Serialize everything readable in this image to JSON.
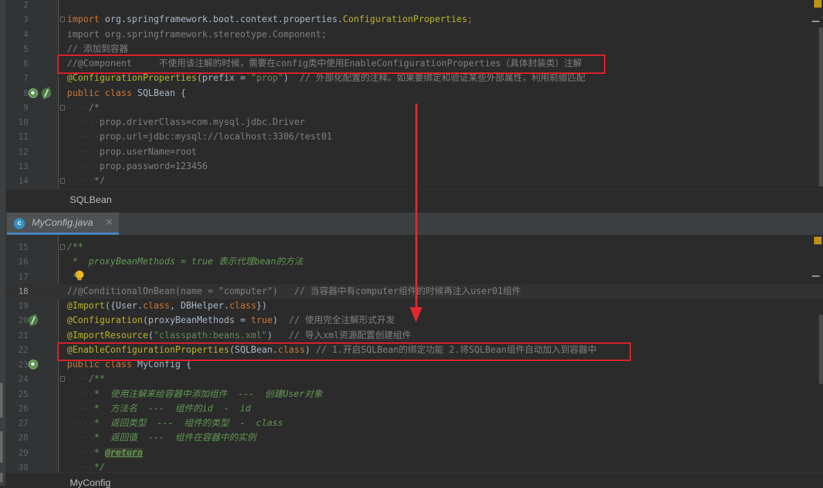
{
  "top_editor": {
    "lines": [
      {
        "num": "2",
        "tokens": []
      },
      {
        "num": "3",
        "tokens": [
          {
            "t": "import ",
            "c": "kw"
          },
          {
            "t": "org.springframework.boot.context.properties."
          },
          {
            "t": "ConfigurationProperties",
            "c": "ann"
          },
          {
            "t": ";",
            "c": "kw"
          }
        ]
      },
      {
        "num": "4",
        "tokens": [
          {
            "t": "import ",
            "c": "cmt"
          },
          {
            "t": "org.springframework.stereotype.Component;",
            "c": "cmt"
          }
        ]
      },
      {
        "num": "5",
        "tokens": [
          {
            "t": "// 添加到容器",
            "c": "cmt"
          }
        ]
      },
      {
        "num": "6",
        "tokens": [
          {
            "t": "//@Component     不使用该注解的时候，需要在config类中使用EnableConfigurationProperties（具体封装类）注解",
            "c": "cmt"
          }
        ]
      },
      {
        "num": "7",
        "tokens": [
          {
            "t": "@ConfigurationProperties",
            "c": "ann"
          },
          {
            "t": "("
          },
          {
            "t": "prefix"
          },
          {
            "t": " = "
          },
          {
            "t": "\"prop\"",
            "c": "str"
          },
          {
            "t": ")  "
          },
          {
            "t": "// 外部化配置的注释。如果要绑定和验证某些外部属性，利用前缀匹配",
            "c": "cmt"
          }
        ]
      },
      {
        "num": "8",
        "tokens": [
          {
            "t": "public ",
            "c": "kw"
          },
          {
            "t": "class ",
            "c": "kw"
          },
          {
            "t": "SQLBean {"
          }
        ]
      },
      {
        "num": "9",
        "tokens": [
          {
            "t": "····",
            "c": "ws"
          },
          {
            "t": "/*",
            "c": "cmt"
          }
        ]
      },
      {
        "num": "10",
        "tokens": [
          {
            "t": "······",
            "c": "ws"
          },
          {
            "t": "prop.driverClass=com.mysql.jdbc.Driver",
            "c": "cmt"
          }
        ]
      },
      {
        "num": "11",
        "tokens": [
          {
            "t": "······",
            "c": "ws"
          },
          {
            "t": "prop.url=jdbc:mysql://localhost:3306/test01",
            "c": "cmt"
          }
        ]
      },
      {
        "num": "12",
        "tokens": [
          {
            "t": "······",
            "c": "ws"
          },
          {
            "t": "prop.userName=root",
            "c": "cmt"
          }
        ]
      },
      {
        "num": "13",
        "tokens": [
          {
            "t": "······",
            "c": "ws"
          },
          {
            "t": "prop.password=123456",
            "c": "cmt"
          }
        ]
      },
      {
        "num": "14",
        "tokens": [
          {
            "t": "·····",
            "c": "ws"
          },
          {
            "t": "*/",
            "c": "cmt"
          }
        ]
      }
    ],
    "breadcrumb": "SQLBean"
  },
  "tab": {
    "icon_letter": "c",
    "title": "MyConfig.java",
    "close": "×"
  },
  "bottom_editor": {
    "lines": [
      {
        "num": "15",
        "tokens": [
          {
            "t": "/**",
            "c": "doc"
          }
        ]
      },
      {
        "num": "16",
        "tokens": [
          {
            "t": " *  proxyBeanMethods = true 表示代理bean的方法",
            "c": "doc"
          }
        ]
      },
      {
        "num": "17",
        "tokens": [
          {
            "t": " *",
            "c": "doc"
          }
        ]
      },
      {
        "num": "18",
        "tokens": [
          {
            "t": "//@ConditionalOnBean(name = \"computer\")   // 当容器中有computer组件的时候再注入user01组件",
            "c": "cmt"
          }
        ]
      },
      {
        "num": "19",
        "tokens": [
          {
            "t": "@Import",
            "c": "ann"
          },
          {
            "t": "({User."
          },
          {
            "t": "class",
            "c": "kw"
          },
          {
            "t": ", "
          },
          {
            "t": "DBHelper."
          },
          {
            "t": "class",
            "c": "kw"
          },
          {
            "t": "})"
          }
        ]
      },
      {
        "num": "20",
        "tokens": [
          {
            "t": "@Configuration",
            "c": "ann"
          },
          {
            "t": "(proxyBeanMethods = "
          },
          {
            "t": "true",
            "c": "kw"
          },
          {
            "t": ")  "
          },
          {
            "t": "// 使用完全注解形式开发",
            "c": "cmt"
          }
        ]
      },
      {
        "num": "21",
        "tokens": [
          {
            "t": "@ImportResource",
            "c": "ann"
          },
          {
            "t": "("
          },
          {
            "t": "\"classpath:beans.xml\"",
            "c": "str"
          },
          {
            "t": ")   "
          },
          {
            "t": "// 导入xml资源配置创建组件",
            "c": "cmt"
          }
        ]
      },
      {
        "num": "22",
        "tokens": [
          {
            "t": "@EnableConfigurationProperties",
            "c": "ann"
          },
          {
            "t": "(SQLBean."
          },
          {
            "t": "class",
            "c": "kw"
          },
          {
            "t": ") "
          },
          {
            "t": "// 1.开启SQLBean的绑定功能 2.将SQLBean组件自动加入到容器中",
            "c": "cmt"
          }
        ]
      },
      {
        "num": "23",
        "tokens": [
          {
            "t": "public ",
            "c": "kw"
          },
          {
            "t": "class ",
            "c": "kw"
          },
          {
            "t": "MyConfig {"
          }
        ]
      },
      {
        "num": "24",
        "tokens": [
          {
            "t": "····",
            "c": "ws"
          },
          {
            "t": "/**",
            "c": "doc"
          }
        ]
      },
      {
        "num": "25",
        "tokens": [
          {
            "t": "·····",
            "c": "ws"
          },
          {
            "t": "*  使用注解来给容器中添加组件  ---  创建User对象",
            "c": "doc"
          }
        ]
      },
      {
        "num": "26",
        "tokens": [
          {
            "t": "·····",
            "c": "ws"
          },
          {
            "t": "*  方法名  ---  组件的id  -  id",
            "c": "doc"
          }
        ]
      },
      {
        "num": "27",
        "tokens": [
          {
            "t": "·····",
            "c": "ws"
          },
          {
            "t": "*  返回类型  ---  组件的类型  -  class",
            "c": "doc"
          }
        ]
      },
      {
        "num": "28",
        "tokens": [
          {
            "t": "·····",
            "c": "ws"
          },
          {
            "t": "*  返回值  ---  组件在容器中的实例",
            "c": "doc"
          }
        ]
      },
      {
        "num": "29",
        "tokens": [
          {
            "t": "·····",
            "c": "ws"
          },
          {
            "t": "* ",
            "c": "doc"
          },
          {
            "t": "@return",
            "c": "doctag"
          }
        ]
      },
      {
        "num": "30",
        "tokens": [
          {
            "t": "·····",
            "c": "ws"
          },
          {
            "t": "*/",
            "c": "doc"
          }
        ]
      }
    ],
    "breadcrumb": "MyConfig"
  },
  "colors": {
    "annotation_box": "#e8212b",
    "arrow": "#e3262d",
    "background": "#2b2b2b"
  }
}
